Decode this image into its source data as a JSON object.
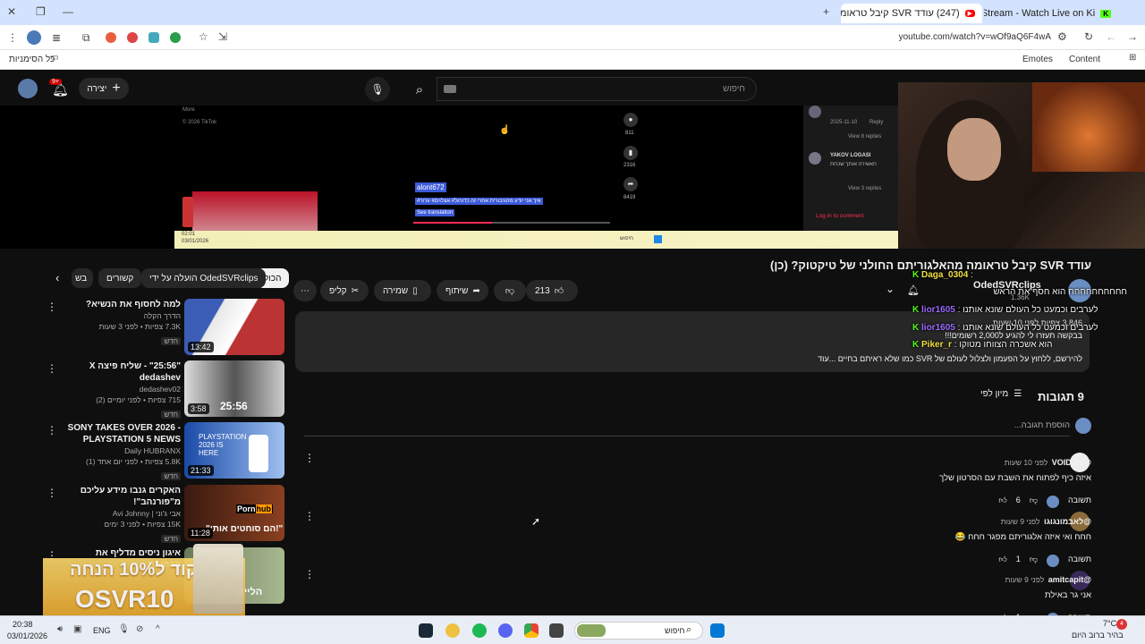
{
  "tabs": [
    {
      "title": "(247) עודד SVR קיבל טראומה מ..."
    },
    {
      "title": "IGZ_ Stream - Watch Live on Ki..."
    }
  ],
  "address": {
    "url": "youtube.com/watch?v=wOf9aQ6F4wA"
  },
  "bookmarks": {
    "all": "כל הסימניות",
    "emotes": "Emotes",
    "content": "Content"
  },
  "yt": {
    "create": "יצירה",
    "notif_badge": "9+",
    "search_placeholder": "חיפוש"
  },
  "video_overlay": {
    "more": "More",
    "copyright": "© 2026 TikTok",
    "user": "alont672",
    "caption_line": "איך אני יודע מהגיבורית אחרי זה כדורגל# אצלוים# ערור#",
    "see_translation": "See translation",
    "likes": "811",
    "saves": "2316",
    "shares": "8419",
    "comment1_meta": "2025-11-10",
    "comment1_reply": "Reply",
    "view8": "View 8 replies",
    "yakov": "YAKOV LOGASI",
    "yakov_text": "האשירה אותך שכחת",
    "view3": "View 3 replies",
    "login": "Log in to comment",
    "inner_time": "02:01",
    "inner_date": "03/01/2026",
    "inner_search": "חיפוש"
  },
  "video": {
    "title": "עודד SVR קיבל טראומה מהאלגוריתם החולני של טיקטוק? (כן)",
    "channel": "OdedSVRclips",
    "subs": "1.36K",
    "likes": "213",
    "share": "שיתוף",
    "save": "שמירה",
    "clip": "קליפ",
    "views": "3,846 צפיות  לפני 10 שעות",
    "desc1": "בבקשה תעזרו לי להגיע ל2,000 רשומים!!!",
    "desc2": "להירשם, ללחוץ על הפעמון ולצלול לעולם של SVR כמו שלא ראיתם בחיים ...עוד"
  },
  "chips": [
    "הכול",
    "הועלה על ידי OdedSVRclips",
    "קשורים",
    "בש"
  ],
  "related": [
    {
      "title": "למה לחסוף את הנשיא?",
      "channel": "הדרך הקלה",
      "meta": "7.3K צפיות • לפני 3 שעות",
      "badge": "חדש",
      "dur": "13:42"
    },
    {
      "title": "\"25:56\" - שליח פיצה X dedashev",
      "channel": "dedashev02",
      "meta": "715 צפיות • לפני יומיים (2)",
      "badge": "חדש",
      "dur": "3:58"
    },
    {
      "title": "SONY TAKES OVER 2026 - PLAYSTATION 5 NEWS",
      "channel": "Daily HUBRANX",
      "meta": "5.8K צפיות • לפני יום אחד (1)",
      "badge": "חדש",
      "dur": "21:33"
    },
    {
      "title": "האקרים גנבו מידע עליכם מ\"פורנהב\"!",
      "channel": "אבי ג'וני | Avi Johnny",
      "meta": "15K צפיות • לפני 3 ימים",
      "badge": "חדש",
      "dur": "11:28"
    },
    {
      "title": "איגון ניסים מדליף את הכתובת",
      "channel": "",
      "meta": "",
      "badge": "",
      "dur": ""
    }
  ],
  "thumb_text": {
    "t2": "25:56",
    "t3": "PLAYSTATION 2026 IS HERE",
    "t4a": "Porn",
    "t4b": "hub",
    "t4c": "\"הם סוחטים אותי!\"",
    "t5": "הלייב"
  },
  "promo": {
    "line1": "קוד ל10% הנחה",
    "line2": "OSVR10"
  },
  "comments": {
    "count": "9 תגובות",
    "sort": "מיון לפי",
    "add": "הוספת תגובה...",
    "reply": "תשובה",
    "items": [
      {
        "author": "@VOID-nv",
        "time": "לפני 10 שעות",
        "text": "איזה כיף לפתוח את השבת עם הסרטון שלך",
        "likes": "6"
      },
      {
        "author": "@לאבמונגוגו",
        "time": "לפני 9 שעות",
        "text": "חחח ואי איזה אלגוריתם מפגר חחח 😂",
        "likes": "1"
      },
      {
        "author": "@amitcapit",
        "time": "לפני 9 שעות",
        "text": "אני גר באילת",
        "likes": "1"
      }
    ]
  },
  "chat": [
    {
      "user": "Daga_0304",
      "text": ":",
      "color": "#f0e040"
    },
    {
      "user": "",
      "text": "חחחחחחחחחח הוא חסף את הראש",
      "color": "#f1f1f1"
    },
    {
      "user": "lior1605",
      "text": ": לערבים וכמעט כל העולם שונא אותנו",
      "color": "#9b6bff"
    },
    {
      "user": "lior1605",
      "text": ": לערבים וכמעט כל העולם שונא אותנו",
      "color": "#9b6bff"
    },
    {
      "user": "Piker_r",
      "text": ": הוא אשכרה הצווחו מטוקו",
      "color": "#f0e040"
    }
  ],
  "taskbar": {
    "time": "20:38",
    "date": "03/01/2026",
    "lang": "ENG",
    "search": "חיפוש",
    "weather": "7°C",
    "weather_desc": "בהיר ברוב היום",
    "badge": "4"
  }
}
